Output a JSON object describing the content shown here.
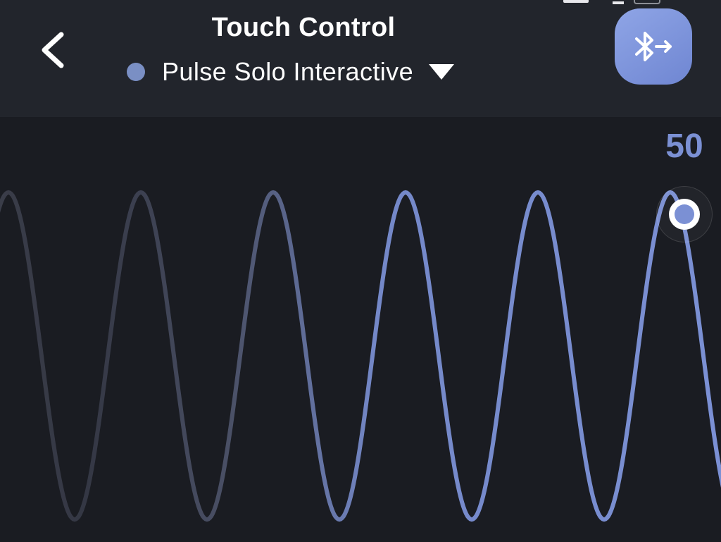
{
  "header": {
    "title": "Touch Control",
    "device": {
      "name": "Pulse Solo Interactive",
      "status_color": "#7a8fc4"
    },
    "back_icon": "chevron-left-icon",
    "bluetooth_icon": "bluetooth-connect-icon"
  },
  "control": {
    "level": "50",
    "accent_color": "#7b90d4",
    "level_fraction": 0.5
  },
  "colors": {
    "background": "#1a1c22",
    "header_bg": "#22252c",
    "wave_start": "#3a3d49",
    "wave_end": "#7b90d4"
  }
}
